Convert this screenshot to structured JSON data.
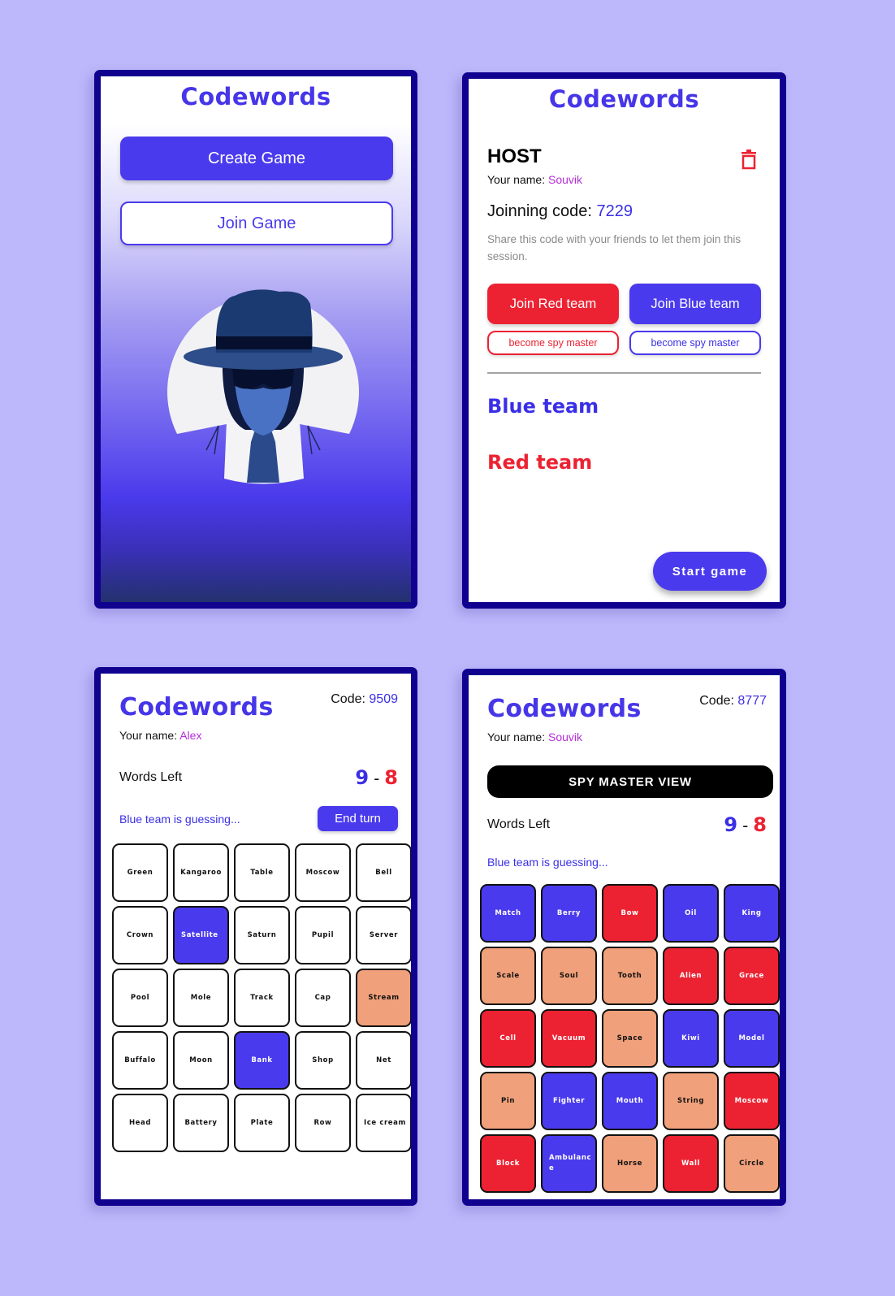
{
  "colors": {
    "background": "#bdb8fb",
    "frame": "#10028f",
    "brand_blue": "#4a3aed",
    "red": "#ec2232",
    "neutral": "#f0a07a",
    "name_purple": "#b42ed7"
  },
  "home": {
    "title": "Codewords",
    "create_label": "Create Game",
    "join_label": "Join Game",
    "illustration": "spy-agent-illustration"
  },
  "lobby": {
    "title": "Codewords",
    "role": "HOST",
    "delete_icon": "trash-icon",
    "name_label": "Your name:",
    "name_value": "Souvik",
    "code_label": "Joinning code:",
    "code_value": "7229",
    "share_note": "Share this code with your friends to let them join this session.",
    "join_red_label": "Join Red team",
    "join_blue_label": "Join Blue team",
    "spy_master_red_label": "become spy master",
    "spy_master_blue_label": "become spy master",
    "blue_team_heading": "Blue team",
    "red_team_heading": "Red team",
    "start_label": "Start game"
  },
  "game_player": {
    "title": "Codewords",
    "code_label": "Code:",
    "code_value": "9509",
    "name_label": "Your name:",
    "name_value": "Alex",
    "words_left_label": "Words Left",
    "blue_left": "9",
    "dash": "-",
    "red_left": "8",
    "status": "Blue team is guessing...",
    "end_turn_label": "End turn",
    "cards": [
      {
        "word": "Green",
        "state": "hidden"
      },
      {
        "word": "Kangaroo",
        "state": "hidden"
      },
      {
        "word": "Table",
        "state": "hidden"
      },
      {
        "word": "Moscow",
        "state": "hidden"
      },
      {
        "word": "Bell",
        "state": "hidden"
      },
      {
        "word": "Crown",
        "state": "hidden"
      },
      {
        "word": "Satellite",
        "state": "blue"
      },
      {
        "word": "Saturn",
        "state": "hidden"
      },
      {
        "word": "Pupil",
        "state": "hidden"
      },
      {
        "word": "Server",
        "state": "hidden"
      },
      {
        "word": "Pool",
        "state": "hidden"
      },
      {
        "word": "Mole",
        "state": "hidden"
      },
      {
        "word": "Track",
        "state": "hidden"
      },
      {
        "word": "Cap",
        "state": "hidden"
      },
      {
        "word": "Stream",
        "state": "neutral"
      },
      {
        "word": "Buffalo",
        "state": "hidden"
      },
      {
        "word": "Moon",
        "state": "hidden"
      },
      {
        "word": "Bank",
        "state": "blue"
      },
      {
        "word": "Shop",
        "state": "hidden"
      },
      {
        "word": "Net",
        "state": "hidden"
      },
      {
        "word": "Head",
        "state": "hidden"
      },
      {
        "word": "Battery",
        "state": "hidden"
      },
      {
        "word": "Plate",
        "state": "hidden"
      },
      {
        "word": "Row",
        "state": "hidden"
      },
      {
        "word": "Ice cream",
        "state": "hidden"
      }
    ]
  },
  "game_spymaster": {
    "title": "Codewords",
    "code_label": "Code:",
    "code_value": "8777",
    "name_label": "Your name:",
    "name_value": "Souvik",
    "view_label": "SPY MASTER VIEW",
    "words_left_label": "Words Left",
    "blue_left": "9",
    "dash": "-",
    "red_left": "8",
    "status": "Blue team is guessing...",
    "cards": [
      {
        "word": "Match",
        "state": "blue"
      },
      {
        "word": "Berry",
        "state": "blue"
      },
      {
        "word": "Bow",
        "state": "red"
      },
      {
        "word": "Oil",
        "state": "blue"
      },
      {
        "word": "King",
        "state": "blue"
      },
      {
        "word": "Scale",
        "state": "neutral"
      },
      {
        "word": "Soul",
        "state": "neutral"
      },
      {
        "word": "Tooth",
        "state": "neutral"
      },
      {
        "word": "Alien",
        "state": "red"
      },
      {
        "word": "Grace",
        "state": "red"
      },
      {
        "word": "Cell",
        "state": "red"
      },
      {
        "word": "Vacuum",
        "state": "red"
      },
      {
        "word": "Space",
        "state": "neutral"
      },
      {
        "word": "Kiwi",
        "state": "blue"
      },
      {
        "word": "Model",
        "state": "blue"
      },
      {
        "word": "Pin",
        "state": "neutral"
      },
      {
        "word": "Fighter",
        "state": "blue"
      },
      {
        "word": "Mouth",
        "state": "blue"
      },
      {
        "word": "String",
        "state": "neutral"
      },
      {
        "word": "Moscow",
        "state": "red"
      },
      {
        "word": "Block",
        "state": "red"
      },
      {
        "word": "Ambulance",
        "state": "blue"
      },
      {
        "word": "Horse",
        "state": "neutral"
      },
      {
        "word": "Wall",
        "state": "red"
      },
      {
        "word": "Circle",
        "state": "neutral"
      }
    ]
  }
}
